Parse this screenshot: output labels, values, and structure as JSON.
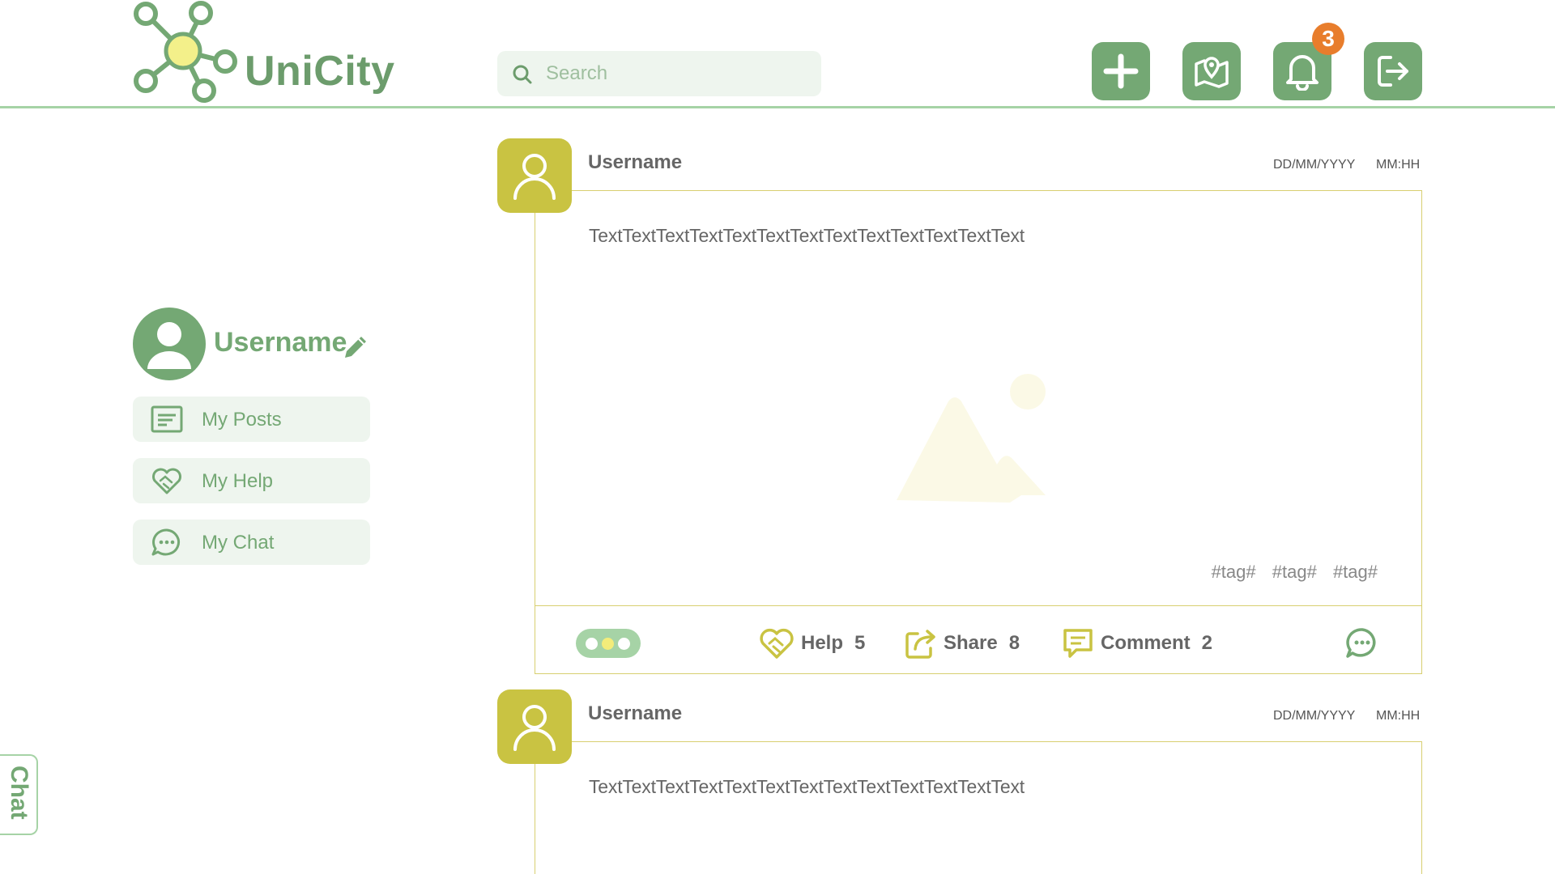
{
  "app": {
    "name": "UniCity"
  },
  "header": {
    "search_placeholder": "Search",
    "notification_count": "3",
    "buttons": [
      "plus-icon",
      "map-pin-icon",
      "bell-icon",
      "logout-icon"
    ]
  },
  "sidebar": {
    "username": "Username",
    "items": [
      {
        "label": "My Posts",
        "icon": "posts-icon"
      },
      {
        "label": "My Help",
        "icon": "help-heart-icon"
      },
      {
        "label": "My Chat",
        "icon": "chat-icon"
      }
    ]
  },
  "posts": [
    {
      "username": "Username",
      "date": "DD/MM/YYYY",
      "time": "MM:HH",
      "text": "TextTextTextTextTextTextTextTextTextTextTextTextText",
      "tags": [
        "#tag#",
        "#tag#",
        "#tag#"
      ],
      "actions": {
        "help_label": "Help",
        "help_count": "5",
        "share_label": "Share",
        "share_count": "8",
        "comment_label": "Comment",
        "comment_count": "2"
      }
    },
    {
      "username": "Username",
      "date": "DD/MM/YYYY",
      "time": "MM:HH",
      "text": "TextTextTextTextTextTextTextTextTextTextTextTextText"
    }
  ],
  "chat_tab": {
    "label": "Chat"
  },
  "colors": {
    "primary_green": "#74a874",
    "light_green": "#a6d3a6",
    "pale_green": "#eef5ee",
    "post_yellow": "#c9c342",
    "badge_orange": "#e87d2c"
  }
}
